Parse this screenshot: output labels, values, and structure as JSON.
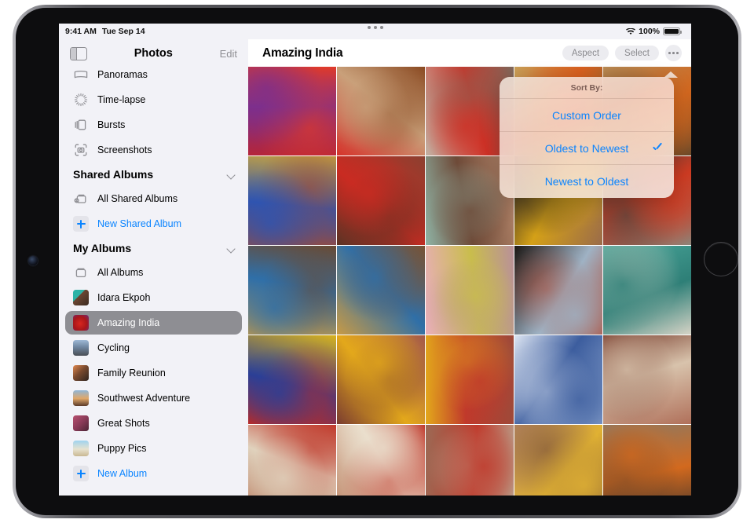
{
  "status_bar": {
    "time": "9:41 AM",
    "date": "Tue Sep 14",
    "wifi_icon": "wifi-icon",
    "battery_percent": "100%",
    "battery_icon": "battery-icon"
  },
  "multitask_handle": "multitask-handle-icon",
  "sidebar": {
    "toggle_icon": "sidebar-toggle-icon",
    "title": "Photos",
    "edit_label": "Edit",
    "rows": [
      {
        "id": "panoramas",
        "label": "Panoramas",
        "type": "icon",
        "icon": "panorama-icon"
      },
      {
        "id": "time-lapse",
        "label": "Time-lapse",
        "type": "icon",
        "icon": "timelapse-icon"
      },
      {
        "id": "bursts",
        "label": "Bursts",
        "type": "icon",
        "icon": "bursts-icon"
      },
      {
        "id": "screenshots",
        "label": "Screenshots",
        "type": "icon",
        "icon": "screenshots-icon"
      },
      {
        "id": "shared-albums",
        "label": "Shared Albums",
        "type": "section",
        "chevron": "chevron-down-icon"
      },
      {
        "id": "all-shared-albums",
        "label": "All Shared Albums",
        "type": "icon",
        "icon": "shared-album-icon"
      },
      {
        "id": "new-shared-album",
        "label": "New Shared Album",
        "type": "add",
        "icon": "plus-icon"
      },
      {
        "id": "my-albums",
        "label": "My Albums",
        "type": "section",
        "chevron": "chevron-down-icon"
      },
      {
        "id": "all-albums",
        "label": "All Albums",
        "type": "icon",
        "icon": "album-icon"
      },
      {
        "id": "idara-ekpoh",
        "label": "Idara Ekpoh",
        "type": "thumb",
        "thumb": "t-idara"
      },
      {
        "id": "amazing-india",
        "label": "Amazing India",
        "type": "thumb",
        "thumb": "t-india",
        "selected": true
      },
      {
        "id": "cycling",
        "label": "Cycling",
        "type": "thumb",
        "thumb": "t-cycling"
      },
      {
        "id": "family-reunion",
        "label": "Family Reunion",
        "type": "thumb",
        "thumb": "t-family"
      },
      {
        "id": "southwest-adventure",
        "label": "Southwest Adventure",
        "type": "thumb",
        "thumb": "t-southwest"
      },
      {
        "id": "great-shots",
        "label": "Great Shots",
        "type": "thumb",
        "thumb": "t-great"
      },
      {
        "id": "puppy-pics",
        "label": "Puppy Pics",
        "type": "thumb",
        "thumb": "t-puppy"
      },
      {
        "id": "new-album",
        "label": "New Album",
        "type": "add",
        "icon": "plus-icon"
      }
    ]
  },
  "content": {
    "title": "Amazing India",
    "toolbar": {
      "aspect_label": "Aspect",
      "select_label": "Select",
      "more_icon": "ellipsis-icon"
    },
    "photos": [
      {
        "id": "p1",
        "alt": "red chili peppers on purple cloth",
        "c1": "#b4253a",
        "c2": "#7d2f8c",
        "c3": "#e03a2a"
      },
      {
        "id": "p2",
        "alt": "red sari and sandaled foot on sand",
        "c1": "#d5332b",
        "c2": "#c9a07a",
        "c3": "#8a4a22"
      },
      {
        "id": "p3",
        "alt": "woman in red outfit by wall",
        "c1": "#c2b2a4",
        "c2": "#cf3126",
        "c3": "#7e6a5c"
      },
      {
        "id": "p4",
        "alt": "woman in orange against ochre wall",
        "c1": "#caa057",
        "c2": "#d9601f",
        "c3": "#8d6a32"
      },
      {
        "id": "p5",
        "alt": "man with orange turban",
        "c1": "#b88a53",
        "c2": "#d2671f",
        "c3": "#6b4a2a"
      },
      {
        "id": "p6",
        "alt": "man in blue beside yellow wall",
        "c1": "#c8a43f",
        "c2": "#2f54b0",
        "c3": "#9a4a3a"
      },
      {
        "id": "p7",
        "alt": "woman with curly hair in red top",
        "c1": "#8c4030",
        "c2": "#c92b22",
        "c3": "#5a3324"
      },
      {
        "id": "p8",
        "alt": "close-up of two faces",
        "c1": "#b98a6e",
        "c2": "#6e4a38",
        "c3": "#8fb3a5"
      },
      {
        "id": "p9",
        "alt": "woman in striped dress",
        "c1": "#9a6b4a",
        "c2": "#d4a017",
        "c3": "#2a2422"
      },
      {
        "id": "p10",
        "alt": "man in red kurta by old wall",
        "c1": "#8d8378",
        "c2": "#cf3b22",
        "c3": "#4a443e"
      },
      {
        "id": "p11",
        "alt": "person with patterned headwrap",
        "c1": "#c79a46",
        "c2": "#2f6fa8",
        "c3": "#6a4a32"
      },
      {
        "id": "p12",
        "alt": "two people with headwraps",
        "c1": "#c79a46",
        "c2": "#2f6fa8",
        "c3": "#7a5232"
      },
      {
        "id": "p13",
        "alt": "pink wall with yellow door",
        "c1": "#e9aebb",
        "c2": "#c9bd4c",
        "c3": "#b9909a"
      },
      {
        "id": "p14",
        "alt": "archway onto lawn with red figure",
        "c1": "#1c1714",
        "c2": "#9fb2c4",
        "c3": "#b0442c"
      },
      {
        "id": "p15",
        "alt": "turquoise weathered doors",
        "c1": "#4aa79b",
        "c2": "#2e7f77",
        "c3": "#d6d3c6"
      },
      {
        "id": "p16",
        "alt": "blue fabric bundles and red cloth",
        "c1": "#d8b21d",
        "c2": "#2b3f96",
        "c3": "#c3291f"
      },
      {
        "id": "p17",
        "alt": "person in yellow on red rock",
        "c1": "#a4594a",
        "c2": "#e3a81b",
        "c3": "#7a3c30"
      },
      {
        "id": "p18",
        "alt": "person in red inside red canyon",
        "c1": "#9d4a3a",
        "c2": "#c0392b",
        "c3": "#e3a81b"
      },
      {
        "id": "p19",
        "alt": "blue stepwell architecture",
        "c1": "#8fa7cf",
        "c2": "#3c5d9e",
        "c3": "#dde5f2"
      },
      {
        "id": "p20",
        "alt": "red sandstone palace facade",
        "c1": "#b0705a",
        "c2": "#d8c3ac",
        "c3": "#7b4030"
      },
      {
        "id": "p21",
        "alt": "Humayun tomb facade with red figure",
        "c1": "#b87a5e",
        "c2": "#e0d2bd",
        "c3": "#c0392b"
      },
      {
        "id": "p22",
        "alt": "sandstone arches with woman in red",
        "c1": "#c08a6c",
        "c2": "#eadfcd",
        "c3": "#c0392b"
      },
      {
        "id": "p23",
        "alt": "woman in red on stone stairs",
        "c1": "#9c6a55",
        "c2": "#c0392b",
        "c3": "#b9a18c"
      },
      {
        "id": "p24",
        "alt": "woman in yellow sari walking",
        "c1": "#b8885f",
        "c2": "#e0b133",
        "c3": "#7c5238"
      },
      {
        "id": "p25",
        "alt": "portrait of woman in orange top",
        "c1": "#8a7a66",
        "c2": "#d2691e",
        "c3": "#4e3a2c"
      }
    ]
  },
  "popover": {
    "header": "Sort By:",
    "items": [
      {
        "id": "custom-order",
        "label": "Custom Order",
        "checked": false
      },
      {
        "id": "oldest-to-newest",
        "label": "Oldest to Newest",
        "checked": true
      },
      {
        "id": "newest-to-oldest",
        "label": "Newest to Oldest",
        "checked": false
      }
    ],
    "check_icon": "checkmark-icon"
  },
  "colors": {
    "accent_blue": "#0a84ff",
    "sidebar_bg": "#f2f2f7",
    "selected_row": "#8e8e93",
    "pill_bg": "#ececf0"
  }
}
